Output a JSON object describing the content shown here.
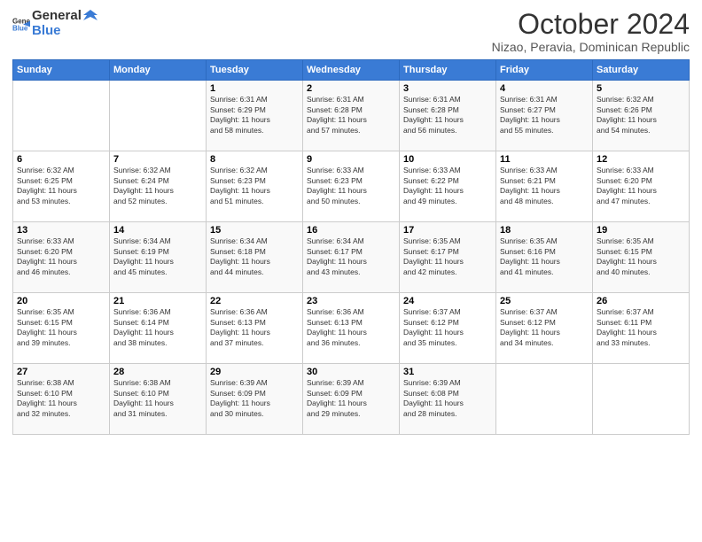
{
  "header": {
    "logo_general": "General",
    "logo_blue": "Blue",
    "title": "October 2024",
    "subtitle": "Nizao, Peravia, Dominican Republic"
  },
  "days_of_week": [
    "Sunday",
    "Monday",
    "Tuesday",
    "Wednesday",
    "Thursday",
    "Friday",
    "Saturday"
  ],
  "weeks": [
    [
      {
        "day": "",
        "info": ""
      },
      {
        "day": "",
        "info": ""
      },
      {
        "day": "1",
        "info": "Sunrise: 6:31 AM\nSunset: 6:29 PM\nDaylight: 11 hours\nand 58 minutes."
      },
      {
        "day": "2",
        "info": "Sunrise: 6:31 AM\nSunset: 6:28 PM\nDaylight: 11 hours\nand 57 minutes."
      },
      {
        "day": "3",
        "info": "Sunrise: 6:31 AM\nSunset: 6:28 PM\nDaylight: 11 hours\nand 56 minutes."
      },
      {
        "day": "4",
        "info": "Sunrise: 6:31 AM\nSunset: 6:27 PM\nDaylight: 11 hours\nand 55 minutes."
      },
      {
        "day": "5",
        "info": "Sunrise: 6:32 AM\nSunset: 6:26 PM\nDaylight: 11 hours\nand 54 minutes."
      }
    ],
    [
      {
        "day": "6",
        "info": "Sunrise: 6:32 AM\nSunset: 6:25 PM\nDaylight: 11 hours\nand 53 minutes."
      },
      {
        "day": "7",
        "info": "Sunrise: 6:32 AM\nSunset: 6:24 PM\nDaylight: 11 hours\nand 52 minutes."
      },
      {
        "day": "8",
        "info": "Sunrise: 6:32 AM\nSunset: 6:23 PM\nDaylight: 11 hours\nand 51 minutes."
      },
      {
        "day": "9",
        "info": "Sunrise: 6:33 AM\nSunset: 6:23 PM\nDaylight: 11 hours\nand 50 minutes."
      },
      {
        "day": "10",
        "info": "Sunrise: 6:33 AM\nSunset: 6:22 PM\nDaylight: 11 hours\nand 49 minutes."
      },
      {
        "day": "11",
        "info": "Sunrise: 6:33 AM\nSunset: 6:21 PM\nDaylight: 11 hours\nand 48 minutes."
      },
      {
        "day": "12",
        "info": "Sunrise: 6:33 AM\nSunset: 6:20 PM\nDaylight: 11 hours\nand 47 minutes."
      }
    ],
    [
      {
        "day": "13",
        "info": "Sunrise: 6:33 AM\nSunset: 6:20 PM\nDaylight: 11 hours\nand 46 minutes."
      },
      {
        "day": "14",
        "info": "Sunrise: 6:34 AM\nSunset: 6:19 PM\nDaylight: 11 hours\nand 45 minutes."
      },
      {
        "day": "15",
        "info": "Sunrise: 6:34 AM\nSunset: 6:18 PM\nDaylight: 11 hours\nand 44 minutes."
      },
      {
        "day": "16",
        "info": "Sunrise: 6:34 AM\nSunset: 6:17 PM\nDaylight: 11 hours\nand 43 minutes."
      },
      {
        "day": "17",
        "info": "Sunrise: 6:35 AM\nSunset: 6:17 PM\nDaylight: 11 hours\nand 42 minutes."
      },
      {
        "day": "18",
        "info": "Sunrise: 6:35 AM\nSunset: 6:16 PM\nDaylight: 11 hours\nand 41 minutes."
      },
      {
        "day": "19",
        "info": "Sunrise: 6:35 AM\nSunset: 6:15 PM\nDaylight: 11 hours\nand 40 minutes."
      }
    ],
    [
      {
        "day": "20",
        "info": "Sunrise: 6:35 AM\nSunset: 6:15 PM\nDaylight: 11 hours\nand 39 minutes."
      },
      {
        "day": "21",
        "info": "Sunrise: 6:36 AM\nSunset: 6:14 PM\nDaylight: 11 hours\nand 38 minutes."
      },
      {
        "day": "22",
        "info": "Sunrise: 6:36 AM\nSunset: 6:13 PM\nDaylight: 11 hours\nand 37 minutes."
      },
      {
        "day": "23",
        "info": "Sunrise: 6:36 AM\nSunset: 6:13 PM\nDaylight: 11 hours\nand 36 minutes."
      },
      {
        "day": "24",
        "info": "Sunrise: 6:37 AM\nSunset: 6:12 PM\nDaylight: 11 hours\nand 35 minutes."
      },
      {
        "day": "25",
        "info": "Sunrise: 6:37 AM\nSunset: 6:12 PM\nDaylight: 11 hours\nand 34 minutes."
      },
      {
        "day": "26",
        "info": "Sunrise: 6:37 AM\nSunset: 6:11 PM\nDaylight: 11 hours\nand 33 minutes."
      }
    ],
    [
      {
        "day": "27",
        "info": "Sunrise: 6:38 AM\nSunset: 6:10 PM\nDaylight: 11 hours\nand 32 minutes."
      },
      {
        "day": "28",
        "info": "Sunrise: 6:38 AM\nSunset: 6:10 PM\nDaylight: 11 hours\nand 31 minutes."
      },
      {
        "day": "29",
        "info": "Sunrise: 6:39 AM\nSunset: 6:09 PM\nDaylight: 11 hours\nand 30 minutes."
      },
      {
        "day": "30",
        "info": "Sunrise: 6:39 AM\nSunset: 6:09 PM\nDaylight: 11 hours\nand 29 minutes."
      },
      {
        "day": "31",
        "info": "Sunrise: 6:39 AM\nSunset: 6:08 PM\nDaylight: 11 hours\nand 28 minutes."
      },
      {
        "day": "",
        "info": ""
      },
      {
        "day": "",
        "info": ""
      }
    ]
  ]
}
